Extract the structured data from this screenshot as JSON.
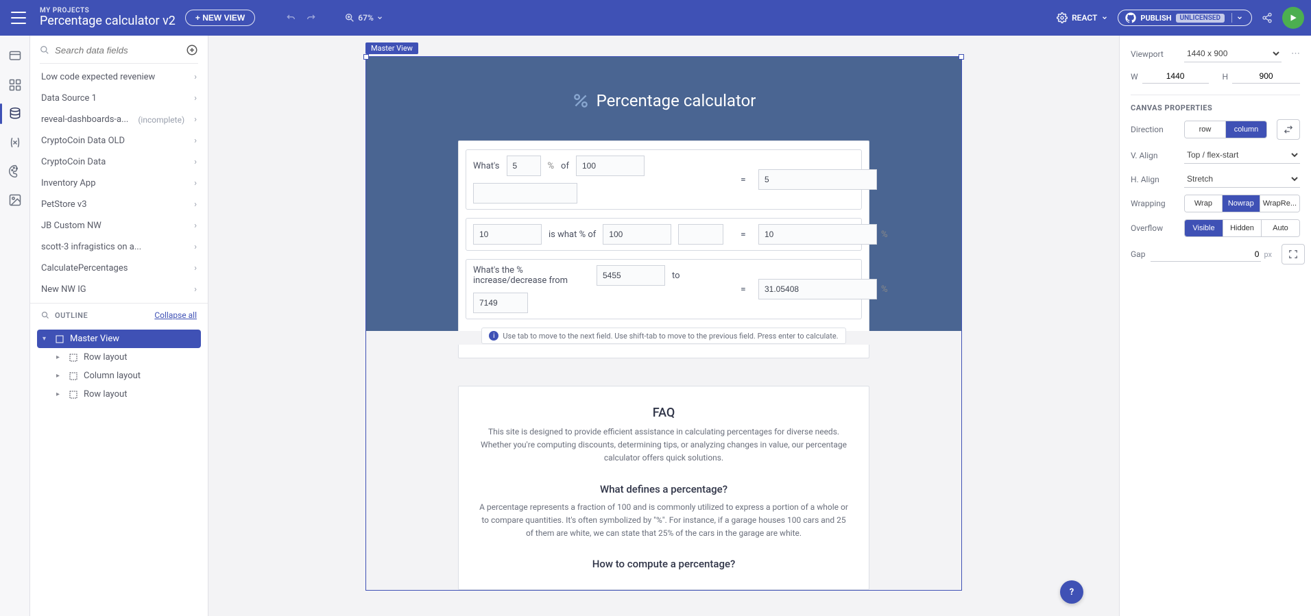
{
  "header": {
    "breadcrumb": "MY PROJECTS",
    "project_name": "Percentage calculator v2",
    "new_view_btn": "+ NEW VIEW",
    "zoom": "67%",
    "framework": "REACT",
    "publish_label": "PUBLISH",
    "license_badge": "UNLICENSED"
  },
  "sidepanel": {
    "search_placeholder": "Search data fields",
    "sources": [
      {
        "name": "Low code expected reveniew",
        "status": ""
      },
      {
        "name": "Data Source 1",
        "status": ""
      },
      {
        "name": "reveal-dashboards-a...",
        "status": "(incomplete)"
      },
      {
        "name": "CryptoCoin Data OLD",
        "status": ""
      },
      {
        "name": "CryptoCoin Data",
        "status": ""
      },
      {
        "name": "Inventory App",
        "status": ""
      },
      {
        "name": "PetStore v3",
        "status": ""
      },
      {
        "name": "JB Custom NW",
        "status": ""
      },
      {
        "name": "scott-3 infragistics on a...",
        "status": ""
      },
      {
        "name": "CalculatePercentages",
        "status": ""
      },
      {
        "name": "New NW IG",
        "status": ""
      }
    ],
    "outline_title": "OUTLINE",
    "collapse_all": "Collapse all",
    "tree": {
      "root": "Master View",
      "children": [
        "Row layout",
        "Column layout",
        "Row layout"
      ]
    }
  },
  "canvas": {
    "master_tag": "Master View",
    "title": "Percentage calculator",
    "row1": {
      "q": "What's",
      "v1": "5",
      "sym": "%",
      "mid": "of",
      "v2": "100",
      "res": "5"
    },
    "row2": {
      "v1": "10",
      "mid": "is what % of",
      "v2": "100",
      "res": "10"
    },
    "row3": {
      "q": "What's the % increase/decrease from",
      "v1": "5455",
      "mid": "to",
      "v2": "7149",
      "res": "31.05408"
    },
    "hint": "Use tab to move to the next field. Use shift-tab to move to the previous field. Press enter to calculate.",
    "faq": {
      "title": "FAQ",
      "p1": "This site is designed to provide efficient assistance in calculating percentages for diverse needs. Whether you're computing discounts, determining tips, or analyzing changes in value, our percentage calculator offers quick solutions.",
      "h2": "What defines a percentage?",
      "p2": "A percentage represents a fraction of 100 and is commonly utilized to express a portion of a whole or to compare quantities. It's often symbolized by \"%\". For instance, if a garage houses 100 cars and 25 of them are white, we can state that 25% of the cars in the garage are white.",
      "h3": "How to compute a percentage?"
    }
  },
  "props": {
    "viewport_label": "Viewport",
    "viewport_value": "1440 x 900",
    "w_label": "W",
    "w": "1440",
    "h_label": "H",
    "h": "900",
    "section": "CANVAS PROPERTIES",
    "direction_label": "Direction",
    "direction": {
      "row": "row",
      "column": "column"
    },
    "valign_label": "V. Align",
    "valign": "Top / flex-start",
    "halign_label": "H. Align",
    "halign": "Stretch",
    "wrap_label": "Wrapping",
    "wrap": {
      "wrap": "Wrap",
      "nowrap": "Nowrap",
      "wrapre": "WrapRe..."
    },
    "overflow_label": "Overflow",
    "overflow": {
      "visible": "Visible",
      "hidden": "Hidden",
      "auto": "Auto"
    },
    "gap_label": "Gap",
    "gap_value": "0",
    "gap_unit": "px"
  }
}
